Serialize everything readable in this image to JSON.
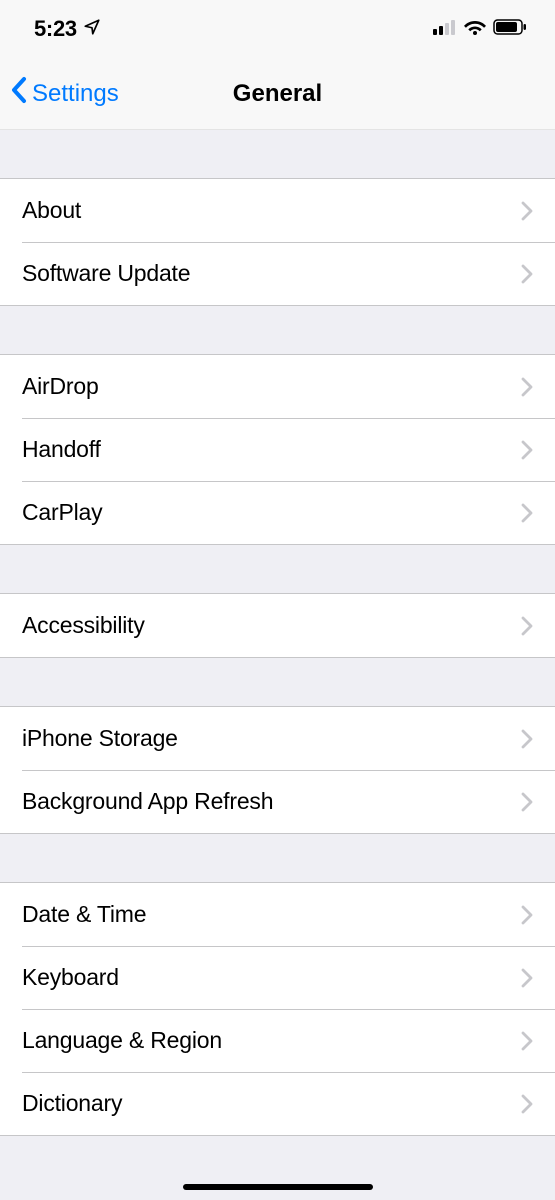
{
  "status": {
    "time": "5:23"
  },
  "nav": {
    "back_label": "Settings",
    "title": "General"
  },
  "groups": [
    {
      "items": [
        {
          "key": "about",
          "label": "About"
        },
        {
          "key": "software-update",
          "label": "Software Update"
        }
      ]
    },
    {
      "items": [
        {
          "key": "airdrop",
          "label": "AirDrop"
        },
        {
          "key": "handoff",
          "label": "Handoff"
        },
        {
          "key": "carplay",
          "label": "CarPlay"
        }
      ]
    },
    {
      "items": [
        {
          "key": "accessibility",
          "label": "Accessibility"
        }
      ]
    },
    {
      "items": [
        {
          "key": "iphone-storage",
          "label": "iPhone Storage"
        },
        {
          "key": "background-app-refresh",
          "label": "Background App Refresh"
        }
      ]
    },
    {
      "items": [
        {
          "key": "date-time",
          "label": "Date & Time"
        },
        {
          "key": "keyboard",
          "label": "Keyboard"
        },
        {
          "key": "language-region",
          "label": "Language & Region"
        },
        {
          "key": "dictionary",
          "label": "Dictionary"
        }
      ]
    }
  ]
}
